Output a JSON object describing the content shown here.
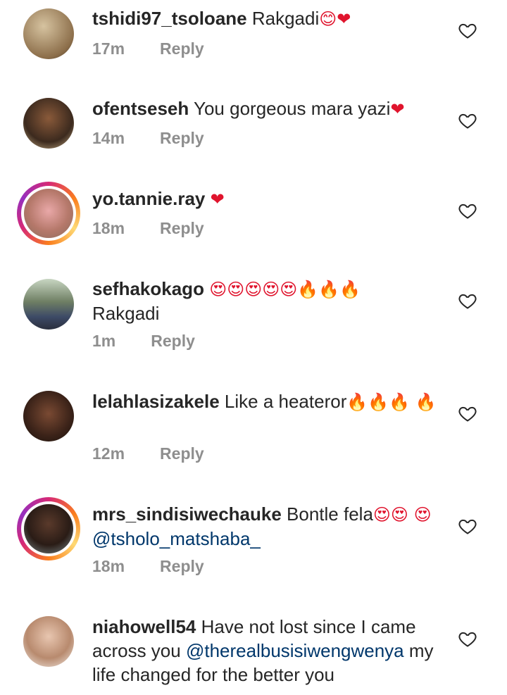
{
  "comments": [
    {
      "username": "tshidi97_tsoloane",
      "text": " Rakgadi",
      "emoji_after": "😊❤",
      "mention": "",
      "time": "17m",
      "reply_label": "Reply",
      "story_ring": false
    },
    {
      "username": "ofentseseh",
      "text": " You gorgeous mara yazi",
      "emoji_after": "❤",
      "mention": "",
      "time": "14m",
      "reply_label": "Reply",
      "story_ring": false
    },
    {
      "username": "yo.tannie.ray",
      "text": " ",
      "emoji_after": "❤",
      "mention": "",
      "time": "18m",
      "reply_label": "Reply",
      "story_ring": true
    },
    {
      "username": "sefhakokago",
      "text": " ",
      "emoji_after": "😍😍😍😍😍🔥🔥🔥",
      "text2": "Rakgadi",
      "mention": "",
      "time": "1m",
      "reply_label": "Reply",
      "story_ring": false
    },
    {
      "username": "lelahlasizakele",
      "text": " Like a heateror",
      "emoji_after": "🔥🔥🔥 🔥",
      "mention": "",
      "time": "12m",
      "reply_label": "Reply",
      "story_ring": false
    },
    {
      "username": "mrs_sindisiwechauke",
      "text": " Bontle fela",
      "emoji_after": "😍😍 😍",
      "mention": "@tsholo_matshaba_",
      "time": "18m",
      "reply_label": "Reply",
      "story_ring": true
    },
    {
      "username": "niahowell54",
      "text": " Have not lost since I came across you",
      "emoji_after": "",
      "mention": "@therealbusisiwengwenya",
      "text_after_mention": " my life changed for the better you",
      "time": "",
      "reply_label": "",
      "story_ring": false
    }
  ],
  "icons": {
    "like": "heart-outline-icon"
  },
  "colors": {
    "heart": "#e0142d",
    "muted": "#8e8e8e",
    "mention": "#00376b"
  }
}
